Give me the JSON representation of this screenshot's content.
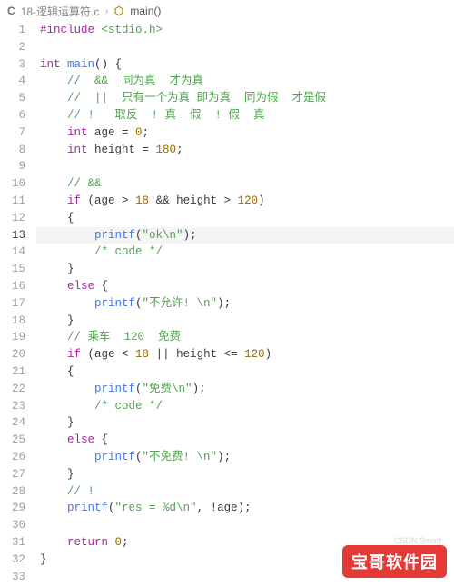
{
  "breadcrumb": {
    "lang_icon": "C",
    "file": "18-逻辑运算符.c",
    "sep": "›",
    "symbol": "main()"
  },
  "current_line_index": 12,
  "lines": [
    {
      "n": 1,
      "tokens": [
        [
          "pp",
          "#include "
        ],
        [
          "inc",
          "<stdio.h>"
        ]
      ]
    },
    {
      "n": 2,
      "tokens": []
    },
    {
      "n": 3,
      "tokens": [
        [
          "type",
          "int "
        ],
        [
          "fn",
          "main"
        ],
        [
          "pun",
          "() {"
        ]
      ]
    },
    {
      "n": 4,
      "tokens": [
        [
          "pun",
          "    "
        ],
        [
          "cmt",
          "//  &&  同为真  才为真"
        ]
      ]
    },
    {
      "n": 5,
      "tokens": [
        [
          "pun",
          "    "
        ],
        [
          "cmt",
          "//  ||  只有一个为真 即为真  同为假  才是假"
        ]
      ]
    },
    {
      "n": 6,
      "tokens": [
        [
          "pun",
          "    "
        ],
        [
          "cmt",
          "// !   取反  ! 真  假  ! 假  真"
        ]
      ]
    },
    {
      "n": 7,
      "tokens": [
        [
          "pun",
          "    "
        ],
        [
          "type",
          "int "
        ],
        [
          "id",
          "age = "
        ],
        [
          "num",
          "0"
        ],
        [
          "pun",
          ";"
        ]
      ]
    },
    {
      "n": 8,
      "tokens": [
        [
          "pun",
          "    "
        ],
        [
          "type",
          "int "
        ],
        [
          "id",
          "height = "
        ],
        [
          "num",
          "180"
        ],
        [
          "pun",
          ";"
        ]
      ]
    },
    {
      "n": 9,
      "tokens": []
    },
    {
      "n": 10,
      "tokens": [
        [
          "pun",
          "    "
        ],
        [
          "cmt",
          "// &&"
        ]
      ]
    },
    {
      "n": 11,
      "tokens": [
        [
          "pun",
          "    "
        ],
        [
          "kw",
          "if "
        ],
        [
          "pun",
          "(age > "
        ],
        [
          "num",
          "18"
        ],
        [
          "pun",
          " && height > "
        ],
        [
          "num",
          "120"
        ],
        [
          "pun",
          ")"
        ]
      ]
    },
    {
      "n": 12,
      "tokens": [
        [
          "pun",
          "    {"
        ]
      ]
    },
    {
      "n": 13,
      "tokens": [
        [
          "pun",
          "        "
        ],
        [
          "fn",
          "printf"
        ],
        [
          "pun",
          "("
        ],
        [
          "str",
          "\"ok\\n\""
        ],
        [
          "pun",
          ");"
        ]
      ]
    },
    {
      "n": 14,
      "tokens": [
        [
          "pun",
          "        "
        ],
        [
          "cmt",
          "/* code */"
        ]
      ]
    },
    {
      "n": 15,
      "tokens": [
        [
          "pun",
          "    }"
        ]
      ]
    },
    {
      "n": 16,
      "tokens": [
        [
          "pun",
          "    "
        ],
        [
          "kw",
          "else "
        ],
        [
          "pun",
          "{"
        ]
      ]
    },
    {
      "n": 17,
      "tokens": [
        [
          "pun",
          "        "
        ],
        [
          "fn",
          "printf"
        ],
        [
          "pun",
          "("
        ],
        [
          "str",
          "\"不允许! \\n\""
        ],
        [
          "pun",
          ");"
        ]
      ]
    },
    {
      "n": 18,
      "tokens": [
        [
          "pun",
          "    }"
        ]
      ]
    },
    {
      "n": 19,
      "tokens": [
        [
          "pun",
          "    "
        ],
        [
          "cmt",
          "// 乘车  120  免费"
        ]
      ]
    },
    {
      "n": 20,
      "tokens": [
        [
          "pun",
          "    "
        ],
        [
          "kw",
          "if "
        ],
        [
          "pun",
          "(age < "
        ],
        [
          "num",
          "18"
        ],
        [
          "pun",
          " || height <= "
        ],
        [
          "num",
          "120"
        ],
        [
          "pun",
          ")"
        ]
      ]
    },
    {
      "n": 21,
      "tokens": [
        [
          "pun",
          "    {"
        ]
      ]
    },
    {
      "n": 22,
      "tokens": [
        [
          "pun",
          "        "
        ],
        [
          "fn",
          "printf"
        ],
        [
          "pun",
          "("
        ],
        [
          "str",
          "\"免费\\n\""
        ],
        [
          "pun",
          ");"
        ]
      ]
    },
    {
      "n": 23,
      "tokens": [
        [
          "pun",
          "        "
        ],
        [
          "cmt",
          "/* code */"
        ]
      ]
    },
    {
      "n": 24,
      "tokens": [
        [
          "pun",
          "    }"
        ]
      ]
    },
    {
      "n": 25,
      "tokens": [
        [
          "pun",
          "    "
        ],
        [
          "kw",
          "else "
        ],
        [
          "pun",
          "{"
        ]
      ]
    },
    {
      "n": 26,
      "tokens": [
        [
          "pun",
          "        "
        ],
        [
          "fn",
          "printf"
        ],
        [
          "pun",
          "("
        ],
        [
          "str",
          "\"不免费! \\n\""
        ],
        [
          "pun",
          ");"
        ]
      ]
    },
    {
      "n": 27,
      "tokens": [
        [
          "pun",
          "    }"
        ]
      ]
    },
    {
      "n": 28,
      "tokens": [
        [
          "pun",
          "    "
        ],
        [
          "cmt",
          "// !"
        ]
      ]
    },
    {
      "n": 29,
      "tokens": [
        [
          "pun",
          "    "
        ],
        [
          "fn",
          "printf"
        ],
        [
          "pun",
          "("
        ],
        [
          "str",
          "\"res = %d\\n\""
        ],
        [
          "pun",
          ", !age);"
        ]
      ]
    },
    {
      "n": 30,
      "tokens": []
    },
    {
      "n": 31,
      "tokens": [
        [
          "pun",
          "    "
        ],
        [
          "kw",
          "return "
        ],
        [
          "num",
          "0"
        ],
        [
          "pun",
          ";"
        ]
      ]
    },
    {
      "n": 32,
      "tokens": [
        [
          "pun",
          "}"
        ]
      ]
    },
    {
      "n": 33,
      "tokens": []
    }
  ],
  "watermark": {
    "main": "宝哥软件园",
    "sub": "CSDN Smart"
  }
}
